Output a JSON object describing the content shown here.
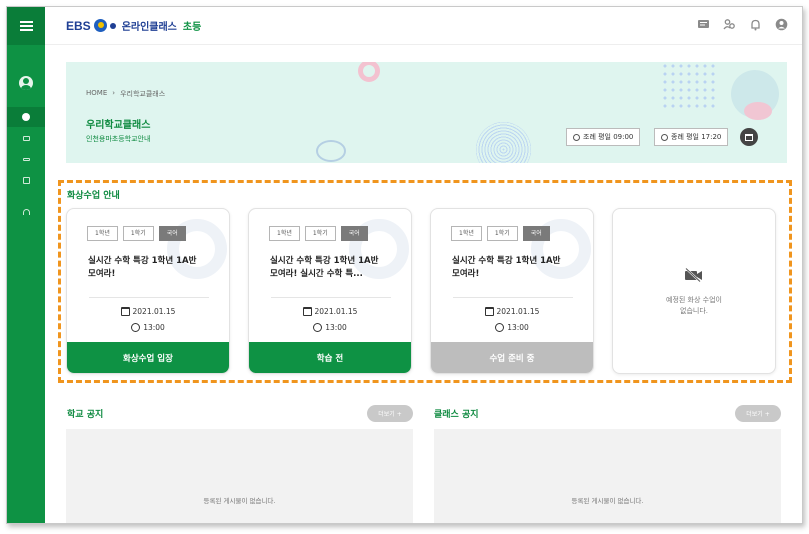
{
  "header": {
    "logo": {
      "brand": "EBS",
      "text1": "온라인클래스",
      "text2": "초등"
    },
    "icons": [
      "message-icon",
      "users-icon",
      "bell-icon",
      "account-icon"
    ]
  },
  "sidebar": {
    "icons": [
      "menu-icon",
      "profile-icon",
      "class-icon",
      "sound-icon",
      "list-icon",
      "copy-icon",
      "headset-icon"
    ]
  },
  "banner": {
    "breadcrumb": [
      "HOME",
      "›",
      "우리학교클래스"
    ],
    "title": "우리학교클래스",
    "subtitle": "인천용마초등학교안내",
    "attendance": "조례 평일 09:00",
    "dismissal": "종례 평일 17:20"
  },
  "live": {
    "section_title": "화상수업 안내",
    "cards": [
      {
        "tags": [
          "1학년",
          "1학기",
          "국어"
        ],
        "title": "실시간 수학 특강 1학년 1A반 모여라!",
        "date": "2021.01.15",
        "time": "13:00",
        "button": "화상수업 입장"
      },
      {
        "tags": [
          "1학년",
          "1학기",
          "국어"
        ],
        "title": "실시간 수학 특강 1학년 1A반 모여라! 실시간 수학 특...",
        "date": "2021.01.15",
        "time": "13:00",
        "button": "학습 전"
      },
      {
        "tags": [
          "1학년",
          "1학기",
          "국어"
        ],
        "title": "실시간 수학 특강 1학년 1A반 모여라!",
        "date": "2021.01.15",
        "time": "13:00",
        "button": "수업 준비 중"
      }
    ],
    "empty": {
      "line1": "예정된 화상 수업이",
      "line2": "없습니다."
    }
  },
  "notices": {
    "school": {
      "title": "학교 공지",
      "more": "더보기 +",
      "empty": "등록된 게시물이 없습니다."
    },
    "class": {
      "title": "클래스 공지",
      "more": "더보기 +",
      "empty": "등록된 게시물이 없습니다."
    }
  },
  "colors": {
    "primary": "#0e9244",
    "accent_dashed": "#f0951e",
    "disabled": "#bdbdbd",
    "banner_bg": "#dff5ef"
  }
}
